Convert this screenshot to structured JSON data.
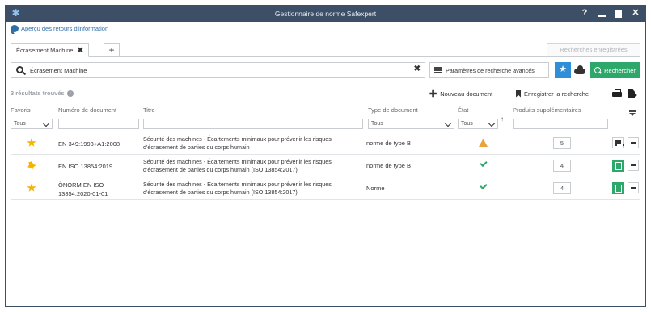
{
  "window": {
    "title": "Gestionnaire de norme Safexpert"
  },
  "titlebar": {
    "help": "?",
    "close": "✕"
  },
  "feedback": {
    "label": "Aperçu des retours d'information"
  },
  "tabs": [
    {
      "label": "Écrasement Machine"
    }
  ],
  "tab_add": "+",
  "saved_searches": "Recherches enregistrées",
  "search": {
    "value": "Écrasement Machine",
    "advanced_label": "Paramètres de recherche avancés",
    "button_label": "Rechercher"
  },
  "results": {
    "count_label": "3 résultats trouvés",
    "new_document": "Nouveau document",
    "save_search": "Enregistrer la recherche"
  },
  "columns": {
    "favorites": "Favoris",
    "number": "Numéro de document",
    "title": "Titre",
    "type": "Type de document",
    "state": "État",
    "extra": "Produits supplémentaires"
  },
  "filters": {
    "favorites": "Tous",
    "type": "Tous",
    "state": "Tous"
  },
  "rows": [
    {
      "favorite": "star-filled",
      "number": "EN 349:1993+A1:2008",
      "title": "Sécurité des machines - Écartements minimaux pour prévenir les risques d'écrasement de parties du corps humain",
      "type": "norme de type B",
      "state": "warning",
      "extra": "5",
      "action": "cart"
    },
    {
      "favorite": "star-half",
      "number": "EN ISO 13854:2019",
      "title": "Sécurité des machines - Écartements minimaux pour prévenir les risques d'écrasement de parties du corps humain (ISO 13854:2017)",
      "type": "norme de type B",
      "state": "ok",
      "extra": "4",
      "action": "pdf"
    },
    {
      "favorite": "star-filled",
      "number": "ÖNORM EN ISO 13854:2020-01-01",
      "title": "Sécurité des machines - Écartements minimaux pour prévenir les risques d'écrasement de parties du corps humain (ISO 13854:2017)",
      "type": "Norme",
      "state": "ok",
      "extra": "4",
      "action": "pdf"
    }
  ],
  "colors": {
    "titlebar": "#3d4e67",
    "accent_blue": "#2e8ed8",
    "accent_green": "#2ea86a",
    "warning": "#e8a33a",
    "star": "#f4b400"
  }
}
